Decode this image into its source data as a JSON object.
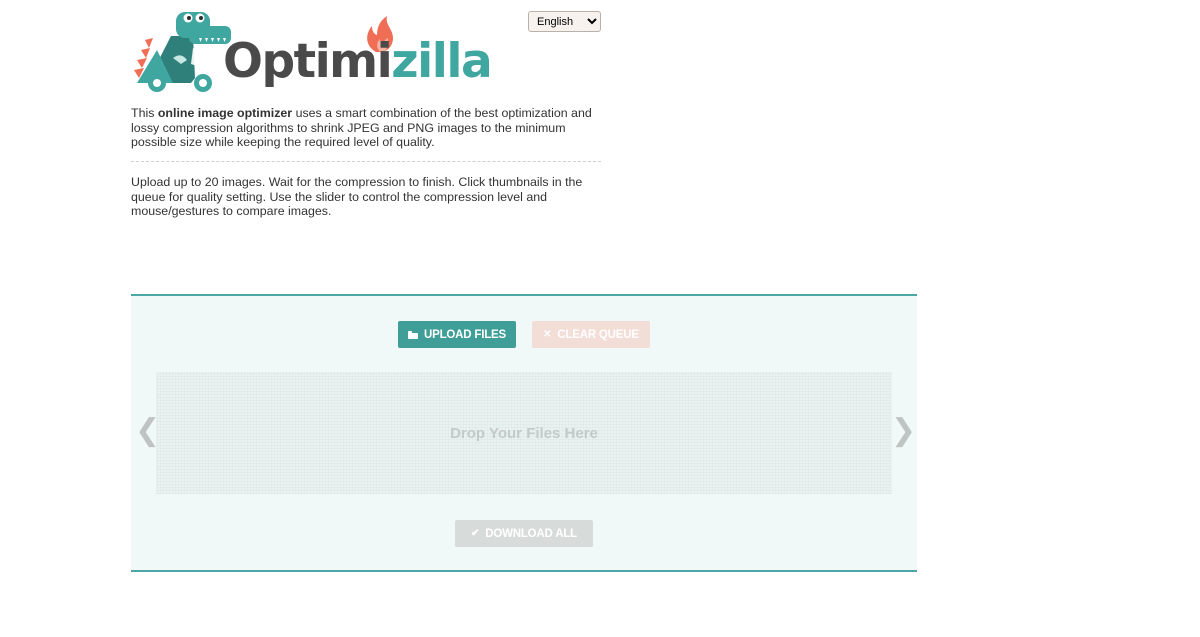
{
  "logo": {
    "word_part1": "Optimi",
    "word_part2": "zilla",
    "mascot": "dinosaur-mascot",
    "flame": "flame-icon"
  },
  "language": {
    "selected": "English",
    "icon": "chevron-down-icon"
  },
  "intro": {
    "lead": "This ",
    "bold": "online image optimizer",
    "rest": " uses a smart combination of the best optimization and lossy compression algorithms to shrink JPEG and PNG images to the minimum possible size while keeping the required level of quality."
  },
  "instructions": "Upload up to 20 images. Wait for the compression to finish. Click thumbnails in the queue for quality setting. Use the slider to control the compression level and mouse/gestures to compare images.",
  "panel": {
    "upload_label": "UPLOAD FILES",
    "upload_icon": "folder-open-icon",
    "clear_label": "CLEAR QUEUE",
    "clear_icon": "close-icon",
    "drop_text": "Drop Your Files Here",
    "prev_arrow": "❮",
    "next_arrow": "❯",
    "download_label": "DOWNLOAD ALL",
    "download_icon": "check-icon"
  },
  "colors": {
    "accent": "#3f9e98",
    "panel_bg": "#f0f9f7",
    "panel_border": "#4aa7a3",
    "brand_dark": "#4a4a4a",
    "brand_teal": "#3fa6a0",
    "flame": "#ef6e55"
  }
}
